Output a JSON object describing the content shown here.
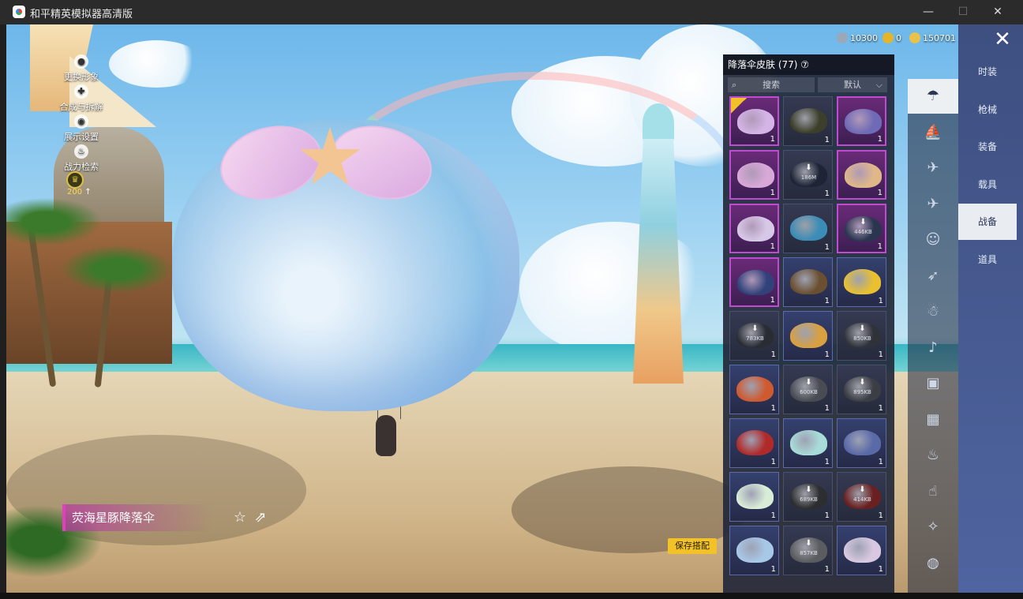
{
  "window": {
    "title": "和平精英模拟器高清版",
    "minimize": "—",
    "maximize": "☐",
    "close": "✕"
  },
  "left_menu": [
    {
      "label": "更换形象",
      "icon": "person-icon"
    },
    {
      "label": "合成与拆解",
      "icon": "merge-icon"
    },
    {
      "label": "展示设置",
      "icon": "eye-icon"
    },
    {
      "label": "战力检索",
      "icon": "fire-icon"
    }
  ],
  "badge": {
    "value": "200",
    "arrow": "↑"
  },
  "currency": [
    {
      "value": "10300",
      "color": "#9aa8b8"
    },
    {
      "value": "0",
      "color": "#e2b52a"
    },
    {
      "value": "150701",
      "color": "#e8c24a"
    }
  ],
  "item": {
    "name": "荧海星豚降落伞",
    "fav_icon": "☆",
    "share_icon": "⇗"
  },
  "save_button": "保存搭配",
  "panel": {
    "title": "降落伞皮肤 (77) ⑦",
    "search_placeholder": "搜索",
    "sort_label": "默认",
    "sort_arrow": "⌵"
  },
  "grid": [
    {
      "rarity": "purple",
      "color": "#d4b4e6",
      "qty": "1",
      "dl": "",
      "equipped": true
    },
    {
      "rarity": "",
      "color": "#3c3f2a",
      "qty": "1",
      "dl": ""
    },
    {
      "rarity": "purple",
      "color": "#6f6ab6",
      "qty": "1",
      "dl": ""
    },
    {
      "rarity": "purple",
      "color": "#d8a8d8",
      "qty": "1",
      "dl": ""
    },
    {
      "rarity": "",
      "color": "#1e2436",
      "qty": "1",
      "dl": "186M"
    },
    {
      "rarity": "purple",
      "color": "#e0b888",
      "qty": "1",
      "dl": ""
    },
    {
      "rarity": "purple",
      "color": "#d8c8e8",
      "qty": "1",
      "dl": ""
    },
    {
      "rarity": "",
      "color": "#3b8cb6",
      "qty": "1",
      "dl": ""
    },
    {
      "rarity": "purple",
      "color": "#2a3550",
      "qty": "1",
      "dl": "446KB"
    },
    {
      "rarity": "purple",
      "color": "#31427a",
      "qty": "1",
      "dl": ""
    },
    {
      "rarity": "blue",
      "color": "#6a5030",
      "qty": "1",
      "dl": ""
    },
    {
      "rarity": "blue",
      "color": "#e8c030",
      "qty": "1",
      "dl": ""
    },
    {
      "rarity": "",
      "color": "#2a2c34",
      "qty": "1",
      "dl": "783KB"
    },
    {
      "rarity": "blue",
      "color": "#d8a040",
      "qty": "1",
      "dl": ""
    },
    {
      "rarity": "",
      "color": "#30323a",
      "qty": "1",
      "dl": "850KB"
    },
    {
      "rarity": "blue",
      "color": "#d05a30",
      "qty": "1",
      "dl": ""
    },
    {
      "rarity": "",
      "color": "#4a4c54",
      "qty": "1",
      "dl": "600KB"
    },
    {
      "rarity": "",
      "color": "#3c3e46",
      "qty": "1",
      "dl": "895KB"
    },
    {
      "rarity": "blue",
      "color": "#b02a2a",
      "qty": "1",
      "dl": ""
    },
    {
      "rarity": "blue",
      "color": "#a8dcd8",
      "qty": "1",
      "dl": ""
    },
    {
      "rarity": "blue",
      "color": "#5a6aa8",
      "qty": "1",
      "dl": ""
    },
    {
      "rarity": "blue",
      "color": "#d8ecd8",
      "qty": "1",
      "dl": ""
    },
    {
      "rarity": "",
      "color": "#2c2e30",
      "qty": "1",
      "dl": "689KB"
    },
    {
      "rarity": "",
      "color": "#6a2020",
      "qty": "1",
      "dl": "414KB"
    },
    {
      "rarity": "blue",
      "color": "#a8c8e8",
      "qty": "1",
      "dl": ""
    },
    {
      "rarity": "",
      "color": "#5a5c60",
      "qty": "1",
      "dl": "857KB"
    },
    {
      "rarity": "blue",
      "color": "#d8c8e0",
      "qty": "1",
      "dl": ""
    }
  ],
  "icon_column": [
    {
      "icon": "parachute-icon",
      "glyph": "☂",
      "active": true
    },
    {
      "icon": "glider-icon",
      "glyph": "⛵"
    },
    {
      "icon": "drone-icon",
      "glyph": "✈"
    },
    {
      "icon": "plane-icon",
      "glyph": "✈"
    },
    {
      "icon": "emote-icon",
      "glyph": "☺"
    },
    {
      "icon": "jet-icon",
      "glyph": "➶"
    },
    {
      "icon": "mascot-icon",
      "glyph": "☃"
    },
    {
      "icon": "sound-icon",
      "glyph": "♪"
    },
    {
      "icon": "pet-icon",
      "glyph": "▣"
    },
    {
      "icon": "gallery-icon",
      "glyph": "▦"
    },
    {
      "icon": "extinguisher-icon",
      "glyph": "♨"
    },
    {
      "icon": "hand-icon",
      "glyph": "☝"
    },
    {
      "icon": "wand-icon",
      "glyph": "✧"
    },
    {
      "icon": "ufo-icon",
      "glyph": "◍"
    }
  ],
  "categories": [
    {
      "label": "时装"
    },
    {
      "label": "枪械"
    },
    {
      "label": "装备"
    },
    {
      "label": "载具"
    },
    {
      "label": "战备",
      "active": true
    },
    {
      "label": "道具"
    }
  ],
  "close_icon": "✕"
}
